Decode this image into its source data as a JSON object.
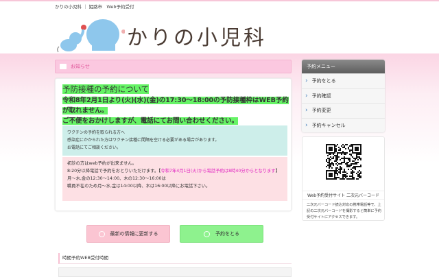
{
  "breadcrumb": {
    "site": "かりの小児科",
    "sep": "｜",
    "city": "姫路市",
    "page": "Web予約受付"
  },
  "header": {
    "site_name": "かりの小児科"
  },
  "notice": {
    "title": "お知らせ",
    "heading": "予防接種の予約について",
    "line1": "令和8年2月1日より(火)(水)(金)の17:30～18:00の予防接種枠はWEB予約が取れません。",
    "line2": "ご不便をおかけしますが、電話にてお問い合わせください。",
    "vaccine": [
      "ワクチンの予約を取られる方へ",
      "感染症にかかられた方はワクチン接種に間隔を空ける必要がある場合があります。",
      "お電話にてご相談ください。"
    ],
    "first_visit": {
      "l1": "初診の方はweb予約が出来ません。",
      "l2a": "8:20分以降電話で予約をおとりいただけます。",
      "l2b": "【",
      "l2c": "令和7年4月1日(火)から電話予約は8時40分からとなります",
      "l2d": "】",
      "l3": "月～水,金の12:30～14:00、木の12:30～16:00は",
      "l4": "職員不在のため月～水,金は14:00以降、木は16:00以降にお電話下さい。"
    }
  },
  "buttons": {
    "refresh": "最新の情報に更新する",
    "reserve": "予約をとる"
  },
  "section": {
    "title": "時間予約WEB受付時間"
  },
  "menu": {
    "title": "予約メニュー",
    "items": [
      "予約をとる",
      "予約確認",
      "予約変更",
      "予約キャンセル"
    ]
  },
  "qr": {
    "caption": "Web予約受付サイト 二次元バーコード",
    "desc": "二次元バーコード読込対応の携帯電話等で、上記の二次元バーコードを撮影すると簡単に予約受付サイトにアクセスできます。"
  },
  "colors": {
    "accent": "#e0569a",
    "green": "#66f366",
    "cyan": "#cdeeea",
    "pink": "#fde0e4"
  }
}
